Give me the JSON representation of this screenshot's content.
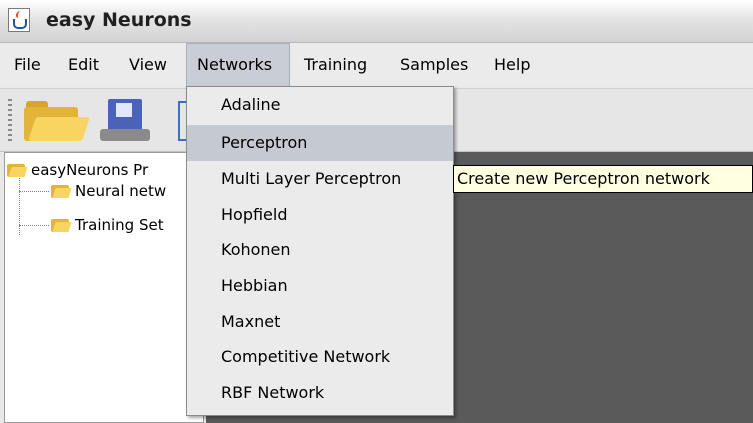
{
  "window": {
    "title": "easy Neurons",
    "icon": "java-cup-icon"
  },
  "menubar": {
    "items": [
      {
        "label": "File"
      },
      {
        "label": "Edit"
      },
      {
        "label": "View"
      },
      {
        "label": "Networks"
      },
      {
        "label": "Training"
      },
      {
        "label": "Samples"
      },
      {
        "label": "Help"
      }
    ],
    "active": "Networks"
  },
  "toolbar": {
    "buttons": [
      "open-folder-icon",
      "save-disk-icon"
    ]
  },
  "tree": {
    "root": "easyNeurons Pr",
    "children": [
      "Neural netw",
      "Training Set"
    ]
  },
  "networks_menu": {
    "items": [
      "Adaline",
      "Perceptron",
      "Multi Layer Perceptron",
      "Hopfield",
      "Kohonen",
      "Hebbian",
      "Maxnet",
      "Competitive Network",
      "RBF Network"
    ],
    "highlighted": "Perceptron"
  },
  "tooltip": {
    "text": "Create new Perceptron network"
  },
  "colors": {
    "desktop": "#5a5a5a",
    "menu_highlight": "#c5cad2",
    "tooltip_bg": "#ffffe1"
  }
}
